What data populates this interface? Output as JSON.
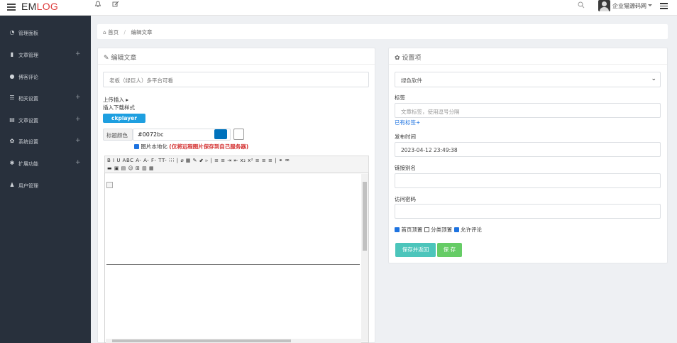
{
  "app": {
    "brand_a": "EM",
    "brand_b": "LOG"
  },
  "topbar": {
    "user": "企业猫源码网",
    "icons": [
      "bell-icon",
      "edit-icon",
      "search-icon",
      "menu-icon"
    ]
  },
  "sidebar": {
    "items": [
      {
        "label": "管理面板",
        "icon": "dashboard-icon",
        "expand": ""
      },
      {
        "label": "文章管理",
        "icon": "bookmark-icon",
        "expand": "+"
      },
      {
        "label": "博客评论",
        "icon": "comment-icon",
        "expand": ""
      },
      {
        "label": "相关设置",
        "icon": "sliders-icon",
        "expand": "+"
      },
      {
        "label": "文章设置",
        "icon": "list-icon",
        "expand": "+"
      },
      {
        "label": "系统设置",
        "icon": "gear-icon",
        "expand": "+"
      },
      {
        "label": "扩展功能",
        "icon": "puzzle-icon",
        "expand": "+"
      },
      {
        "label": "用户管理",
        "icon": "users-icon",
        "expand": ""
      }
    ]
  },
  "breadcrumb": {
    "home": "首页",
    "sep": "/",
    "current": "编辑文章"
  },
  "editor": {
    "header": "编辑文章",
    "title_value": "老板（绿巨人）多平台可看",
    "upload_insert": "上传插入",
    "insert_download_style": "插入下载样式",
    "ckplayer_btn": "ckplayer",
    "title_color_label": "标题颜色",
    "title_color_value": "#0072bc",
    "title_color": "#0072bc",
    "image_localize_label": "图片本地化",
    "image_localize_note": "(仅将远程图片保存到自己服务器)",
    "toolbar_row1": "B I U ABC A- A- F- TT- ⁝⁝⁝ | ⌀ ▦ ✎ ⬋ ▹ | ≡ ≡ ⇥ ⇤ x₂ x² ≡ ≡ ≡ | ⚭ ⚮",
    "toolbar_row2": "▬ ▣ ▤ ☺ ⊞ ▥ ▦"
  },
  "settings": {
    "header": "设置项",
    "category": "绿色软件",
    "tags_label": "标签",
    "tags_placeholder": "文章标签，使用逗号分隔",
    "existing_tags": "已有标签+",
    "publish_time_label": "发布时间",
    "publish_time": "2023-04-12 23:49:38",
    "slug_label": "链接别名",
    "slug_value": "",
    "password_label": "访问密码",
    "password_value": "",
    "check_top": "首页顶置",
    "check_cat_top": "分类顶置",
    "check_comment": "允许评论",
    "save_return_btn": "保存并返回",
    "save_btn": "保 存"
  },
  "colors": {
    "sidebar": "#28303c",
    "accent_teal": "#4cc5bb",
    "accent_green": "#66cc66",
    "ck_blue": "#1e9fe0",
    "brand_red": "#dd3b3b",
    "warn_red": "#d32f2f"
  }
}
